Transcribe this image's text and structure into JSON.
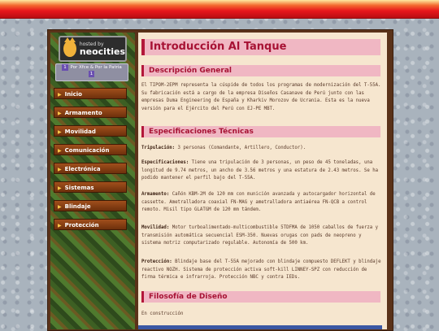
{
  "badge": {
    "hosted": "hosted by",
    "brand": "neocities"
  },
  "petition": {
    "num1": "1",
    "text": "Por Xfce & Por la Patria",
    "num2": "1"
  },
  "nav": [
    "Inicio",
    "Armamento",
    "Movilidad",
    "Comunicación",
    "Electrónica",
    "Sistemas",
    "Blindaje",
    "Protección"
  ],
  "page": {
    "title": "Introducción Al Tanque",
    "desc_heading": "Descripción General",
    "desc_text": "El TIPOM-2EPM representa la cúspide de todos los programas de modernización del T-55A. Su fabricación está a cargo de la empresa Diseños Casanave de Perú junto con las empresas Duma Engineering de España y Kharkiv Morozov de Ucrania. Esta es la nueva versión para el Ejército del Perú con EJ-PE MBT.",
    "spec_heading": "Especificaciones Técnicas",
    "specs": [
      {
        "label": "Tripulación:",
        "text": "3 personas (Comandante, Artillero, Conductor)."
      },
      {
        "label": "Especificaciones:",
        "text": "Tiene una tripulación de 3 personas, un peso de 45 toneladas, una longitud de 9.74 metros, un ancho de 3.56 metros y una estatura de 2.43 metros. Se ha podido mantener el perfil bajo del T-55A."
      },
      {
        "label": "Armamento:",
        "text": "Cañón KBM-2M de 120 mm con munición avanzada y autocargador horizontal de cassette. Ametralladora coaxial FN-MAG y ametralladora antiaérea FN-QCB a control remoto. Misil tipo GLATGM de 120 mm tándem."
      },
      {
        "label": "Movilidad:",
        "text": "Motor turboalimentado-multicombustible 5TDFMA de 1050 caballos de fuerza y transmisión automática secuencial ESM-350. Nuevas orugas con pads de neopreno y sistema motriz computarizado regulable. Autonomía de 500 km."
      },
      {
        "label": "Protección:",
        "text": "Blindaje base del T-55A mejorado con blindaje compuesto DEFLEKT y blindaje reactivo NOZH. Sistema de protección activa soft-kill LINNEY-SPZ con reducción de firma térmica e infrarroja. Protección NBC y contra IEDs."
      }
    ],
    "philo_heading": "Filosofía de Diseño",
    "philo_text": "En construcción"
  }
}
